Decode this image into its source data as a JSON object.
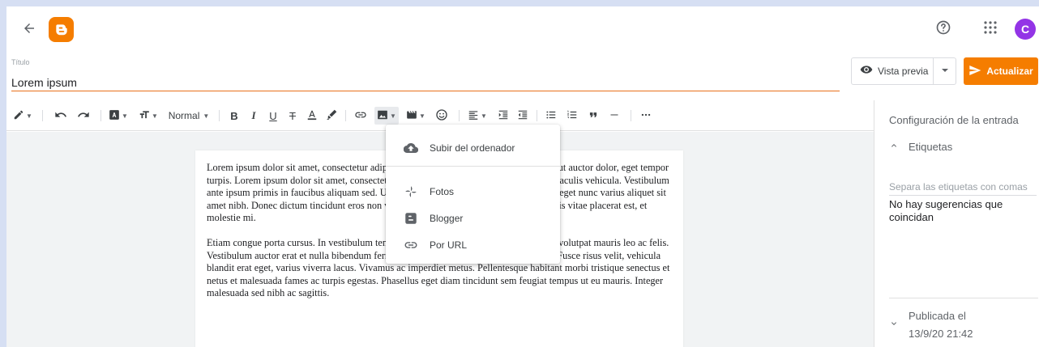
{
  "header": {
    "back_icon": "arrow-back-icon",
    "logo_icon": "blogger-logo-icon",
    "help_icon": "help-circle-icon",
    "apps_icon": "apps-grid-icon",
    "avatar_initial": "C",
    "avatar_color": "#9334e6"
  },
  "post": {
    "title_label": "Título",
    "title_value": "Lorem ipsum",
    "preview_label": "Vista previa",
    "update_label": "Actualizar",
    "accent_color": "#f57d00"
  },
  "toolbar": {
    "paragraph_style": "Normal"
  },
  "content": {
    "paragraph1": "Lorem ipsum dolor sit amet, consectetur adipiscing elit. Integer in aliquet neque. Morbi ut auctor dolor, eget tempor turpis. Lorem ipsum dolor sit amet, consectetur adipiscing elit. Fusce quis odio in nulla iaculis vehicula. Vestibulum ante ipsum primis in faucibus aliquam sed. Ut varius non felis a lacinia. Donec eget nisl eget nunc varius aliquet sit amet nibh. Donec dictum tincidunt eros non vulputate. Donec fermentum diam non mattis vitae placerat est, et molestie mi.",
    "paragraph2": "Etiam congue porta cursus. In vestibulum tempor nisi in nunc sit nulla auctor nunc, non volutpat mauris leo ac felis. Vestibulum auctor erat et nulla bibendum fermentum. Curabitur sit amet tincidunt felis. Fusce risus velit, vehicula blandit erat eget, varius viverra lacus. Vivamus ac imperdiet metus. Pellentesque habitant morbi tristique senectus et netus et malesuada fames ac turpis egestas. Phasellus eget diam tincidunt sem feugiat tempus ut eu mauris. Integer malesuada sed nibh ac sagittis."
  },
  "image_menu": {
    "items": [
      {
        "label": "Subir del ordenador",
        "icon": "cloud-upload-icon"
      },
      {
        "label": "Fotos",
        "icon": "google-photos-icon"
      },
      {
        "label": "Blogger",
        "icon": "blogger-icon"
      },
      {
        "label": "Por URL",
        "icon": "link-icon"
      }
    ]
  },
  "sidebar": {
    "title": "Configuración de la entrada",
    "labels_section": "Etiquetas",
    "labels_placeholder": "Separa las etiquetas con comas",
    "no_suggestions": "No hay sugerencias que coincidan",
    "published_label": "Publicada el",
    "published_date": "13/9/20 21:42"
  }
}
